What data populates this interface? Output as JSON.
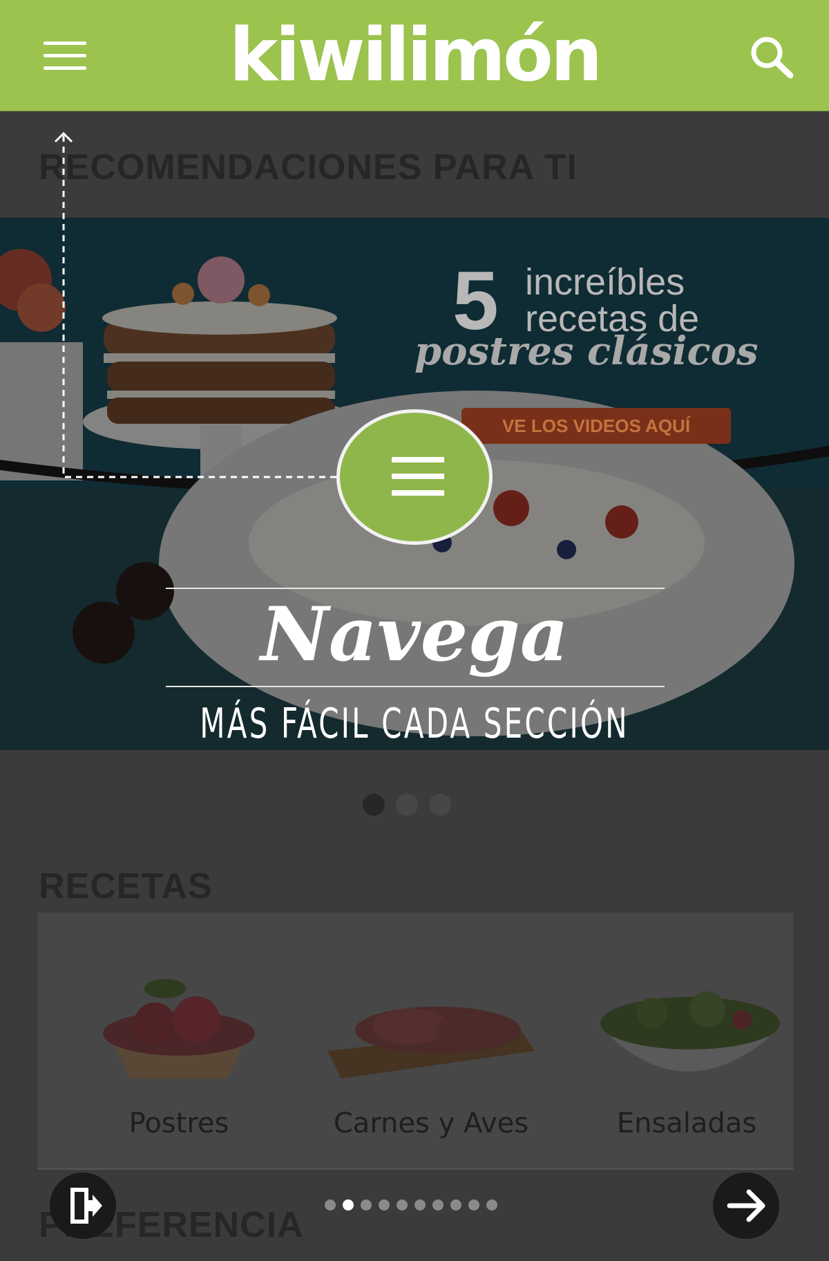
{
  "app": {
    "logo_text": "kiwilimón",
    "brand_color": "#9bc34e",
    "icons": [
      "hamburger-menu-icon",
      "search-icon",
      "exit-icon",
      "arrow-right-icon"
    ]
  },
  "sections": {
    "recommendations_title": "RECOMENDACIONES PARA TI",
    "recipes_title": "RECETAS",
    "preference_title": "PREFERENCIA"
  },
  "banner": {
    "number": "5",
    "line1": "increíbles",
    "line2": "recetas de",
    "line3": "postres clásicos",
    "cta": "VE LOS VIDEOS AQUÍ",
    "dots_total": 3,
    "dots_active": 1
  },
  "recipes": [
    {
      "label": "Postres",
      "icon": "dessert-tart-image"
    },
    {
      "label": "Carnes y Aves",
      "icon": "meat-board-image"
    },
    {
      "label": "Ensaladas",
      "icon": "salad-bowl-image"
    }
  ],
  "tutorial": {
    "title": "Navega",
    "subtitle": "MÁS FÁCIL CADA SECCIÓN",
    "pager_total": 10,
    "pager_active": 2
  }
}
